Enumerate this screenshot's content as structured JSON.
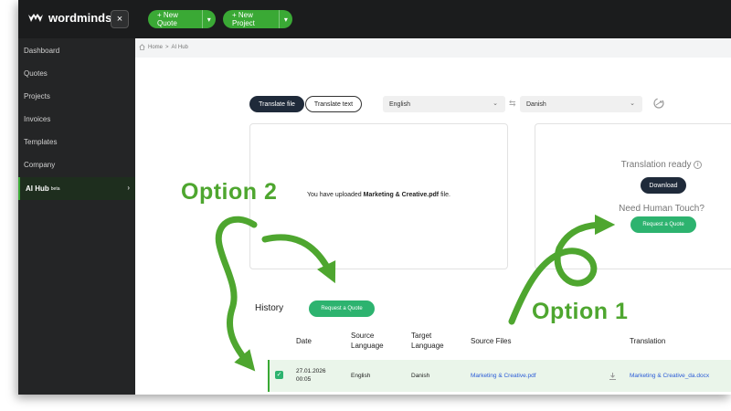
{
  "brand": {
    "name": "wordminds",
    "collapse_label": "×"
  },
  "topbar": {
    "new_quote_label": "+ New Quote",
    "new_project_label": "+ New Project"
  },
  "sidebar": {
    "items": [
      {
        "label": "Dashboard"
      },
      {
        "label": "Quotes"
      },
      {
        "label": "Projects"
      },
      {
        "label": "Invoices"
      },
      {
        "label": "Templates"
      },
      {
        "label": "Company"
      },
      {
        "label": "AI Hub",
        "badge": "beta",
        "active": true
      }
    ]
  },
  "breadcrumb": {
    "home": "Home",
    "separator": ">",
    "current": "AI Hub"
  },
  "translator": {
    "tabs": [
      {
        "label": "Translate file",
        "active": true
      },
      {
        "label": "Translate text",
        "active": false
      }
    ],
    "source_language": "English",
    "target_language": "Danish",
    "swap_icon": "swap-arrows-icon",
    "upload_prefix": "You have uploaded ",
    "upload_filename": "Marketing & Creative.pdf",
    "upload_suffix": " file.",
    "ready_label": "Translation ready",
    "download_label": "Download",
    "human_touch_label": "Need Human Touch?",
    "request_quote_label": "Request a Quote"
  },
  "history": {
    "title": "History",
    "request_quote_label": "Request a Quote",
    "columns": [
      "Date",
      "Source Language",
      "Target Language",
      "Source Files",
      "Translation"
    ],
    "rows": [
      {
        "checked": true,
        "date": "27.01.2026",
        "time": "00:05",
        "source_language": "English",
        "target_language": "Danish",
        "source_file": "Marketing & Creative.pdf",
        "translation_file": "Marketing & Creative_da.docx"
      }
    ]
  },
  "annotations": {
    "option_1": "Option 1",
    "option_2": "Option 2"
  },
  "colors": {
    "accent_green": "#3aa935",
    "quote_green": "#2db36f",
    "annotation_green": "#4ea62f",
    "dark_bg": "#1b1c1d",
    "link_blue": "#2a5bd7"
  }
}
